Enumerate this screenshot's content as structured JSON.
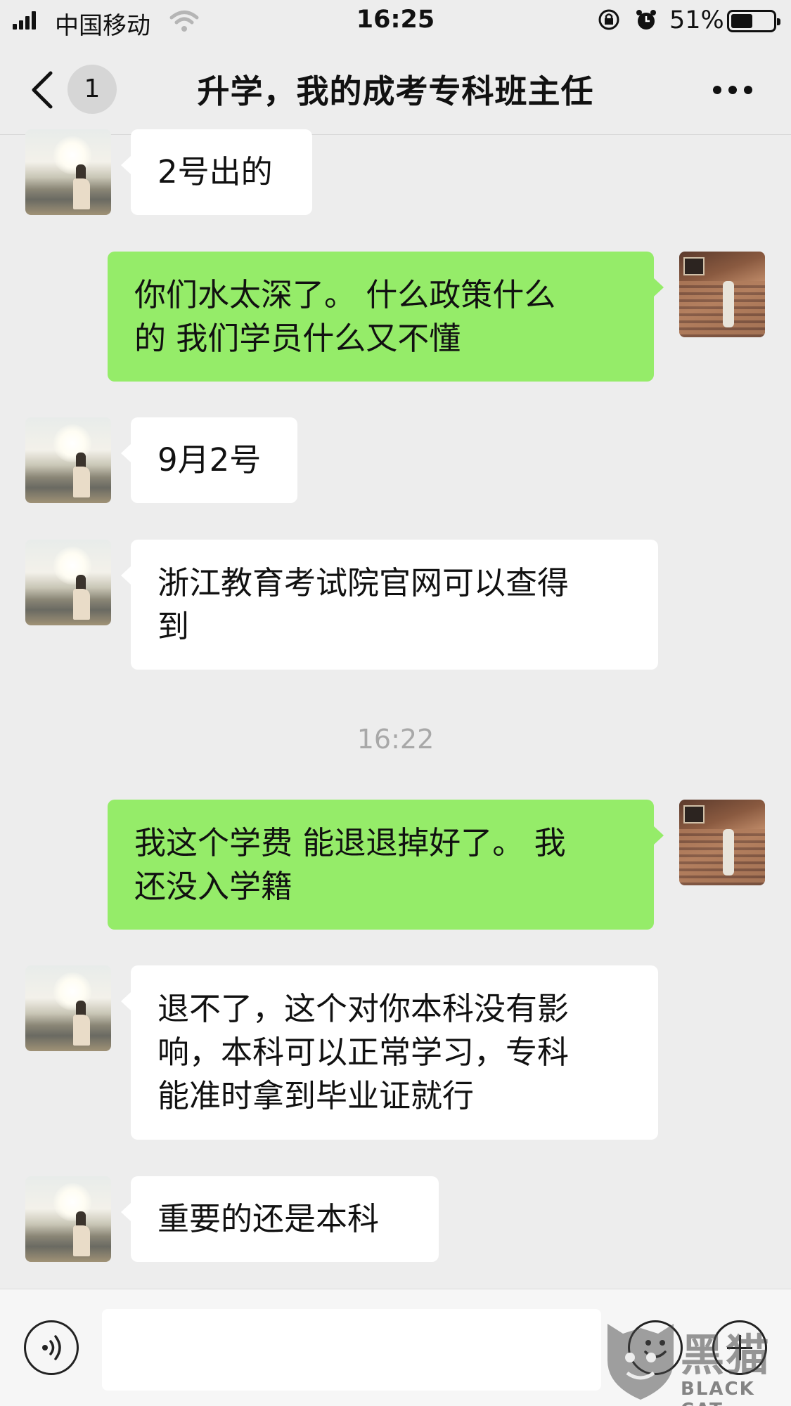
{
  "status_bar": {
    "carrier": "中国移动",
    "time": "16:25",
    "battery_percent": "51%",
    "battery_level": 0.51
  },
  "nav": {
    "back_icon": "chevron-left-icon",
    "unread_count": "1",
    "title": "升学，我的成考专科班主任",
    "more_icon": "more-dots-icon"
  },
  "messages": [
    {
      "side": "left",
      "lines": [
        "2号出的"
      ]
    },
    {
      "side": "right",
      "lines": [
        "你们水太深了。 什么政策什么",
        "的 我们学员什么又不懂"
      ]
    },
    {
      "side": "left",
      "lines": [
        "9月2号"
      ]
    },
    {
      "side": "left",
      "lines": [
        "浙江教育考试院官网可以查得",
        "到"
      ]
    },
    {
      "side": "right",
      "lines": [
        "我这个学费 能退退掉好了。 我",
        "还没入学籍"
      ]
    },
    {
      "side": "left",
      "lines": [
        "退不了，这个对你本科没有影",
        "响，本科可以正常学习，专科",
        "能准时拿到毕业证就行"
      ]
    },
    {
      "side": "left",
      "lines": [
        "重要的还是本科"
      ]
    }
  ],
  "timestamp": "16:22",
  "input_bar": {
    "voice_icon": "voice-icon",
    "emoji_icon": "emoji-icon",
    "plus_icon": "plus-icon"
  },
  "watermark": {
    "cn": "黑猫",
    "en": "BLACK CAT"
  },
  "colors": {
    "background": "#ededed",
    "own_bubble": "#95ec69",
    "other_bubble": "#ffffff",
    "timestamp": "#a8a8a8"
  }
}
